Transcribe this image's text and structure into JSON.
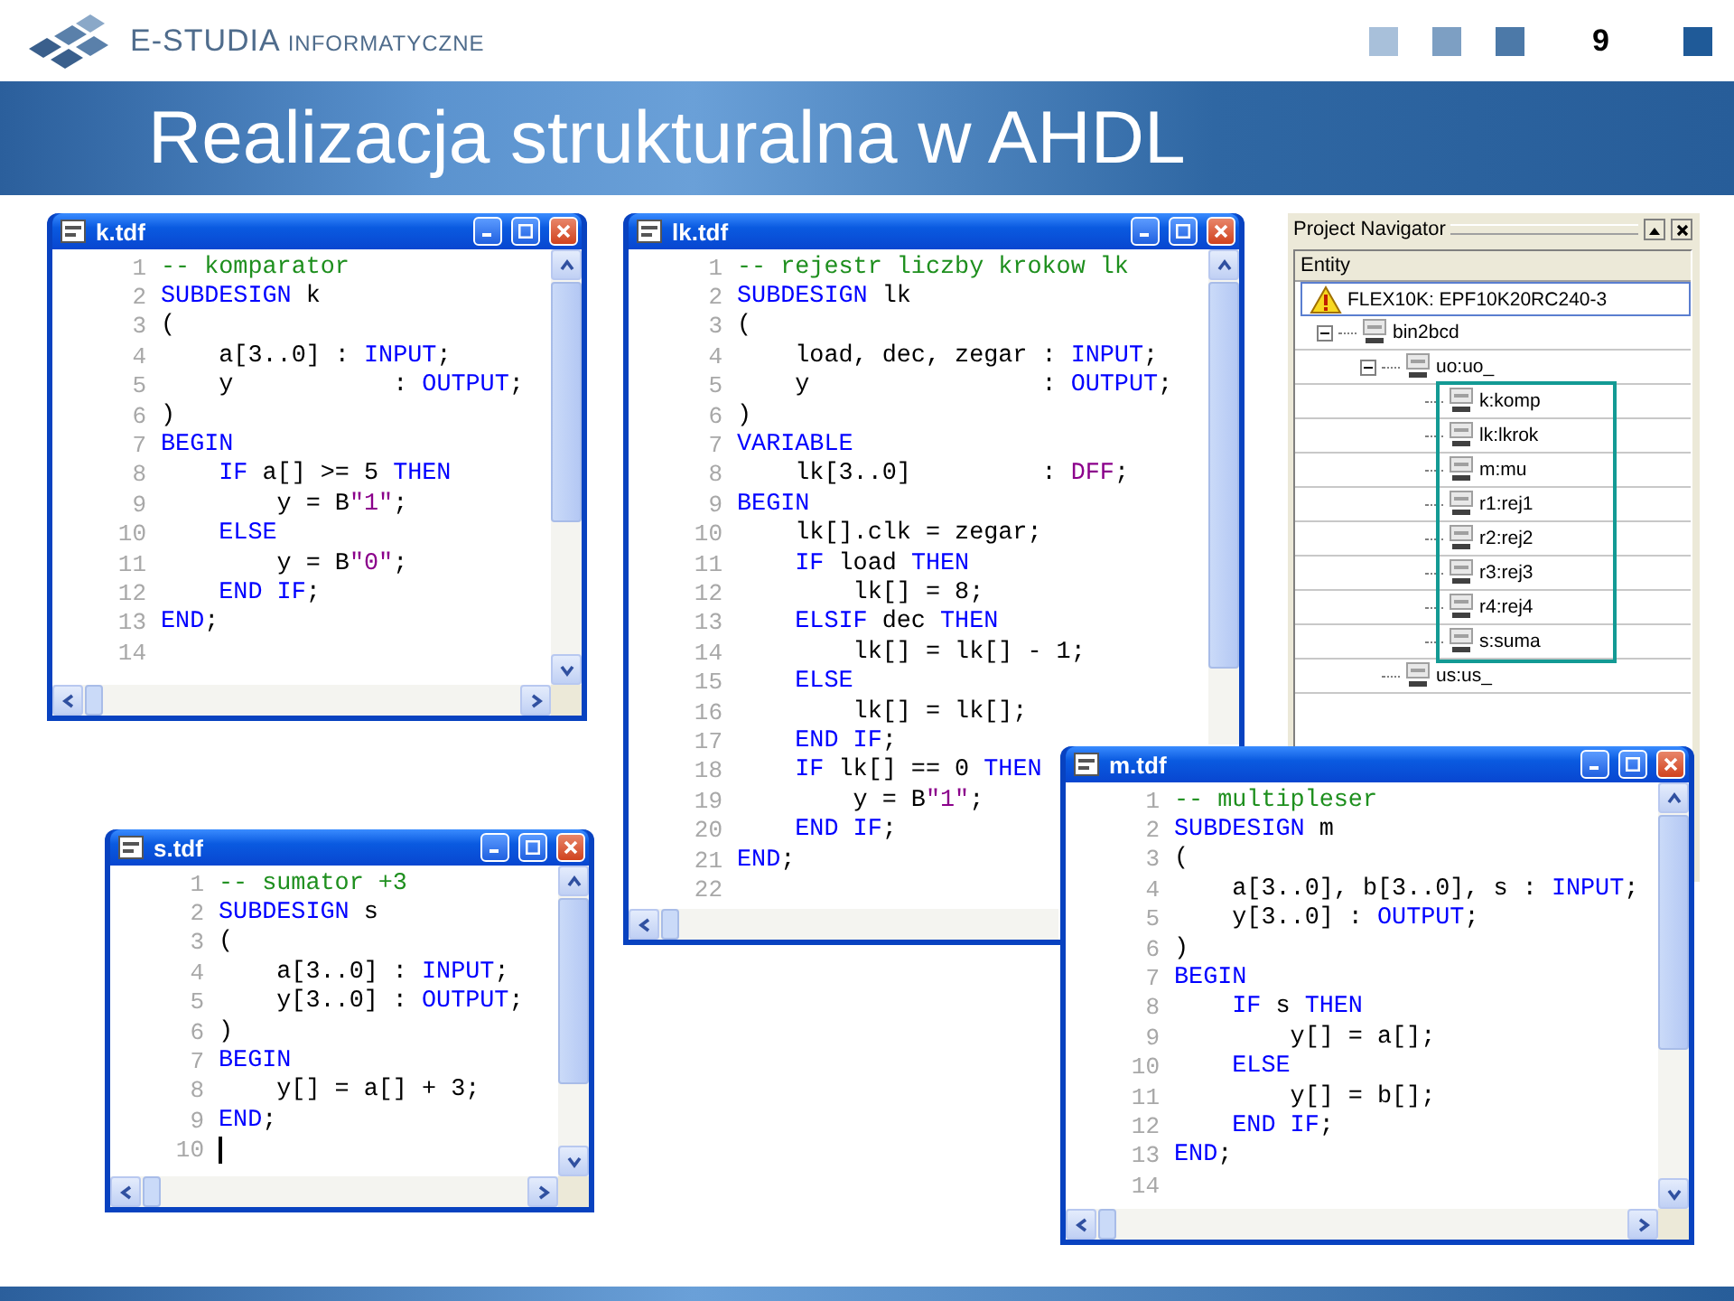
{
  "header": {
    "brand": "E-STUDIA",
    "brand_sub": "INFORMATYCZNE",
    "page_number": "9"
  },
  "title": "Realizacja strukturalna w AHDL",
  "windows": [
    {
      "title": "k.tdf",
      "caret": false,
      "lines": [
        {
          "n": "1",
          "code": [
            {
              "kind": "comment",
              "text": "-- komparator"
            }
          ]
        },
        {
          "n": "2",
          "code": [
            {
              "kind": "keyword",
              "text": "SUBDESIGN"
            },
            {
              "kind": "plain",
              "text": " k"
            }
          ]
        },
        {
          "n": "3",
          "code": [
            {
              "kind": "plain",
              "text": "("
            }
          ]
        },
        {
          "n": "4",
          "code": [
            {
              "kind": "plain",
              "text": "    a[3..0] : "
            },
            {
              "kind": "keyword",
              "text": "INPUT"
            },
            {
              "kind": "plain",
              "text": ";"
            }
          ]
        },
        {
          "n": "5",
          "code": [
            {
              "kind": "plain",
              "text": "    y           : "
            },
            {
              "kind": "keyword",
              "text": "OUTPUT"
            },
            {
              "kind": "plain",
              "text": ";"
            }
          ]
        },
        {
          "n": "6",
          "code": [
            {
              "kind": "plain",
              "text": ")"
            }
          ]
        },
        {
          "n": "7",
          "code": [
            {
              "kind": "keyword",
              "text": "BEGIN"
            }
          ]
        },
        {
          "n": "8",
          "code": [
            {
              "kind": "keyword",
              "text": "    IF"
            },
            {
              "kind": "plain",
              "text": " a[] >= 5 "
            },
            {
              "kind": "keyword",
              "text": "THEN"
            }
          ]
        },
        {
          "n": "9",
          "code": [
            {
              "kind": "plain",
              "text": "        y = B"
            },
            {
              "kind": "literal",
              "text": "\"1\""
            },
            {
              "kind": "plain",
              "text": ";"
            }
          ]
        },
        {
          "n": "10",
          "code": [
            {
              "kind": "keyword",
              "text": "    ELSE"
            }
          ]
        },
        {
          "n": "11",
          "code": [
            {
              "kind": "plain",
              "text": "        y = B"
            },
            {
              "kind": "literal",
              "text": "\"0\""
            },
            {
              "kind": "plain",
              "text": ";"
            }
          ]
        },
        {
          "n": "12",
          "code": [
            {
              "kind": "keyword",
              "text": "    END IF"
            },
            {
              "kind": "plain",
              "text": ";"
            }
          ]
        },
        {
          "n": "13",
          "code": [
            {
              "kind": "keyword",
              "text": "END"
            },
            {
              "kind": "plain",
              "text": ";"
            }
          ]
        },
        {
          "n": "14"
        }
      ]
    },
    {
      "title": "lk.tdf",
      "caret": false,
      "lines": [
        {
          "n": "1",
          "code": [
            {
              "kind": "comment",
              "text": "-- rejestr liczby krokow lk"
            }
          ]
        },
        {
          "n": "2",
          "code": [
            {
              "kind": "keyword",
              "text": "SUBDESIGN"
            },
            {
              "kind": "plain",
              "text": " lk"
            }
          ]
        },
        {
          "n": "3",
          "code": [
            {
              "kind": "plain",
              "text": "("
            }
          ]
        },
        {
          "n": "4",
          "code": [
            {
              "kind": "plain",
              "text": "    load, dec, zegar : "
            },
            {
              "kind": "keyword",
              "text": "INPUT"
            },
            {
              "kind": "plain",
              "text": ";"
            }
          ]
        },
        {
          "n": "5",
          "code": [
            {
              "kind": "plain",
              "text": "    y                : "
            },
            {
              "kind": "keyword",
              "text": "OUTPUT"
            },
            {
              "kind": "plain",
              "text": ";"
            }
          ]
        },
        {
          "n": "6",
          "code": [
            {
              "kind": "plain",
              "text": ")"
            }
          ]
        },
        {
          "n": "7",
          "code": [
            {
              "kind": "keyword",
              "text": "VARIABLE"
            }
          ]
        },
        {
          "n": "8",
          "code": [
            {
              "kind": "plain",
              "text": "    lk[3..0]         : "
            },
            {
              "kind": "literal",
              "text": "DFF"
            },
            {
              "kind": "plain",
              "text": ";"
            }
          ]
        },
        {
          "n": "9",
          "code": [
            {
              "kind": "keyword",
              "text": "BEGIN"
            }
          ]
        },
        {
          "n": "10",
          "code": [
            {
              "kind": "plain",
              "text": "    lk[].clk = zegar;"
            }
          ]
        },
        {
          "n": "11",
          "code": [
            {
              "kind": "keyword",
              "text": "    IF"
            },
            {
              "kind": "plain",
              "text": " load "
            },
            {
              "kind": "keyword",
              "text": "THEN"
            }
          ]
        },
        {
          "n": "12",
          "code": [
            {
              "kind": "plain",
              "text": "        lk[] = 8;"
            }
          ]
        },
        {
          "n": "13",
          "code": [
            {
              "kind": "keyword",
              "text": "    ELSIF"
            },
            {
              "kind": "plain",
              "text": " dec "
            },
            {
              "kind": "keyword",
              "text": "THEN"
            }
          ]
        },
        {
          "n": "14",
          "code": [
            {
              "kind": "plain",
              "text": "        lk[] = lk[] - 1;"
            }
          ]
        },
        {
          "n": "15",
          "code": [
            {
              "kind": "keyword",
              "text": "    ELSE"
            }
          ]
        },
        {
          "n": "16",
          "code": [
            {
              "kind": "plain",
              "text": "        lk[] = lk[];"
            }
          ]
        },
        {
          "n": "17",
          "code": [
            {
              "kind": "keyword",
              "text": "    END IF"
            },
            {
              "kind": "plain",
              "text": ";"
            }
          ]
        },
        {
          "n": "18",
          "code": [
            {
              "kind": "keyword",
              "text": "    IF"
            },
            {
              "kind": "plain",
              "text": " lk[] == 0 "
            },
            {
              "kind": "keyword",
              "text": "THEN"
            }
          ]
        },
        {
          "n": "19",
          "code": [
            {
              "kind": "plain",
              "text": "        y = B"
            },
            {
              "kind": "literal",
              "text": "\"1\""
            },
            {
              "kind": "plain",
              "text": ";"
            }
          ]
        },
        {
          "n": "20",
          "code": [
            {
              "kind": "keyword",
              "text": "    END IF"
            },
            {
              "kind": "plain",
              "text": ";"
            }
          ]
        },
        {
          "n": "21",
          "code": [
            {
              "kind": "keyword",
              "text": "END"
            },
            {
              "kind": "plain",
              "text": ";"
            }
          ]
        },
        {
          "n": "22"
        }
      ]
    },
    {
      "title": "s.tdf",
      "caret": true,
      "lines": [
        {
          "n": "1",
          "code": [
            {
              "kind": "comment",
              "text": "-- sumator +3"
            }
          ]
        },
        {
          "n": "2",
          "code": [
            {
              "kind": "keyword",
              "text": "SUBDESIGN"
            },
            {
              "kind": "plain",
              "text": " s"
            }
          ]
        },
        {
          "n": "3",
          "code": [
            {
              "kind": "plain",
              "text": "("
            }
          ]
        },
        {
          "n": "4",
          "code": [
            {
              "kind": "plain",
              "text": "    a[3..0] : "
            },
            {
              "kind": "keyword",
              "text": "INPUT"
            },
            {
              "kind": "plain",
              "text": ";"
            }
          ]
        },
        {
          "n": "5",
          "code": [
            {
              "kind": "plain",
              "text": "    y[3..0] : "
            },
            {
              "kind": "keyword",
              "text": "OUTPUT"
            },
            {
              "kind": "plain",
              "text": ";"
            }
          ]
        },
        {
          "n": "6",
          "code": [
            {
              "kind": "plain",
              "text": ")"
            }
          ]
        },
        {
          "n": "7",
          "code": [
            {
              "kind": "keyword",
              "text": "BEGIN"
            }
          ]
        },
        {
          "n": "8",
          "code": [
            {
              "kind": "plain",
              "text": "    y[] = a[] + 3;"
            }
          ]
        },
        {
          "n": "9",
          "code": [
            {
              "kind": "keyword",
              "text": "END"
            },
            {
              "kind": "plain",
              "text": ";"
            }
          ]
        },
        {
          "n": "10"
        }
      ]
    },
    {
      "title": "m.tdf",
      "caret": false,
      "lines": [
        {
          "n": "1",
          "code": [
            {
              "kind": "comment",
              "text": "-- multipleser"
            }
          ]
        },
        {
          "n": "2",
          "code": [
            {
              "kind": "keyword",
              "text": "SUBDESIGN"
            },
            {
              "kind": "plain",
              "text": " m"
            }
          ]
        },
        {
          "n": "3",
          "code": [
            {
              "kind": "plain",
              "text": "("
            }
          ]
        },
        {
          "n": "4",
          "code": [
            {
              "kind": "plain",
              "text": "    a[3..0], b[3..0], s : "
            },
            {
              "kind": "keyword",
              "text": "INPUT"
            },
            {
              "kind": "plain",
              "text": ";"
            }
          ]
        },
        {
          "n": "5",
          "code": [
            {
              "kind": "plain",
              "text": "    y[3..0] : "
            },
            {
              "kind": "keyword",
              "text": "OUTPUT"
            },
            {
              "kind": "plain",
              "text": ";"
            }
          ]
        },
        {
          "n": "6",
          "code": [
            {
              "kind": "plain",
              "text": ")"
            }
          ]
        },
        {
          "n": "7",
          "code": [
            {
              "kind": "keyword",
              "text": "BEGIN"
            }
          ]
        },
        {
          "n": "8",
          "code": [
            {
              "kind": "keyword",
              "text": "    IF"
            },
            {
              "kind": "plain",
              "text": " s "
            },
            {
              "kind": "keyword",
              "text": "THEN"
            }
          ]
        },
        {
          "n": "9",
          "code": [
            {
              "kind": "plain",
              "text": "        y[] = a[];"
            }
          ]
        },
        {
          "n": "10",
          "code": [
            {
              "kind": "keyword",
              "text": "    ELSE"
            }
          ]
        },
        {
          "n": "11",
          "code": [
            {
              "kind": "plain",
              "text": "        y[] = b[];"
            }
          ]
        },
        {
          "n": "12",
          "code": [
            {
              "kind": "keyword",
              "text": "    END IF"
            },
            {
              "kind": "plain",
              "text": ";"
            }
          ]
        },
        {
          "n": "13",
          "code": [
            {
              "kind": "keyword",
              "text": "END"
            },
            {
              "kind": "plain",
              "text": ";"
            }
          ]
        },
        {
          "n": "14"
        }
      ]
    }
  ],
  "project_navigator": {
    "title": "Project Navigator",
    "column": "Entity",
    "device": {
      "label": "FLEX10K: EPF10K20RC240-3",
      "selected": true
    },
    "tree": [
      {
        "label": "bin2bcd",
        "expanded": true,
        "framed": false,
        "children": [
          {
            "label": "uo:uo_",
            "expanded": true,
            "framed": true,
            "children": [
              {
                "label": "k:komp"
              },
              {
                "label": "lk:lkrok"
              },
              {
                "label": "m:mu"
              },
              {
                "label": "r1:rej1"
              },
              {
                "label": "r2:rej2"
              },
              {
                "label": "r3:rej3"
              },
              {
                "label": "r4:rej4"
              },
              {
                "label": "s:suma"
              }
            ]
          },
          {
            "label": "us:us_"
          }
        ]
      }
    ]
  }
}
